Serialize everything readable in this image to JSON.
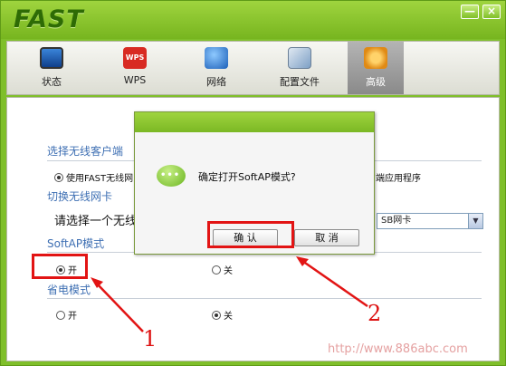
{
  "app": {
    "logo": "FAST"
  },
  "window_buttons": {
    "minimize": "—",
    "close": "×"
  },
  "toolbar": {
    "items": [
      {
        "label": "状态",
        "icon": "status-monitor-icon"
      },
      {
        "label": "WPS",
        "icon": "wps-shield-icon",
        "badge": "WPS"
      },
      {
        "label": "网络",
        "icon": "network-globe-icon"
      },
      {
        "label": "配置文件",
        "icon": "profile-config-icon"
      },
      {
        "label": "高级",
        "icon": "advanced-gear-icon",
        "active": true
      }
    ]
  },
  "panel": {
    "wireless_client_section": "选择无线客户端",
    "client_option_fast": "使用FAST无线网",
    "client_option_other": "端应用程序",
    "switch_card_section": "切换无线网卡",
    "select_card_prompt": "请选择一个无线",
    "card_combo_value": "SB网卡",
    "softap_section": "SoftAP模式",
    "softap_on": "开",
    "softap_off": "关",
    "power_save_section": "省电模式",
    "power_on": "开",
    "power_off": "关"
  },
  "dialog": {
    "message": "确定打开SoftAP模式?",
    "ok_label": "确 认",
    "cancel_label": "取 消"
  },
  "annotations": {
    "step1": "1",
    "step2": "2"
  },
  "watermark": "http://www.886abc.com",
  "colors": {
    "brand_green": "#7fbf2a",
    "annotation_red": "#e21414"
  }
}
